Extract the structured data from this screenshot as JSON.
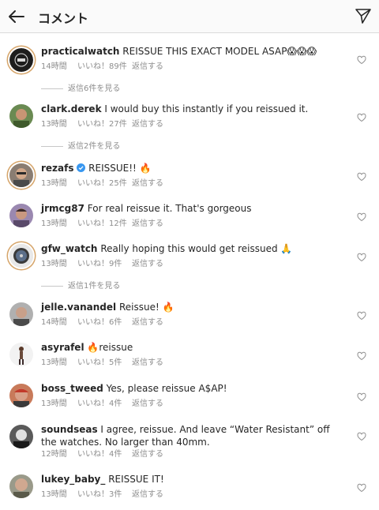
{
  "header": {
    "title": "コメント",
    "back_icon": "back-arrow-icon",
    "send_icon": "paper-plane-icon"
  },
  "comments": [
    {
      "username": "practicalwatch",
      "text": "REISSUE THIS EXACT MODEL ASAP😱😱😱",
      "time": "14時間",
      "likes": "いいね！89件",
      "reply": "返信する",
      "view_replies": "返信6件を見る"
    },
    {
      "username": "clark.derek",
      "text": "I would buy this instantly if you reissued it.",
      "time": "13時間",
      "likes": "いいね！27件",
      "reply": "返信する",
      "view_replies": "返信2件を見る"
    },
    {
      "username": "rezafs",
      "text": "REISSUE!! 🔥",
      "time": "13時間",
      "likes": "いいね！25件",
      "reply": "返信する",
      "verified": true
    },
    {
      "username": "jrmcg87",
      "text": "For real reissue it. That's gorgeous",
      "time": "13時間",
      "likes": "いいね！12件",
      "reply": "返信する"
    },
    {
      "username": "gfw_watch",
      "text": "Really hoping this would get reissued 🙏",
      "time": "13時間",
      "likes": "いいね！9件",
      "reply": "返信する",
      "view_replies": "返信1件を見る"
    },
    {
      "username": "jelle.vanandel",
      "text": "Reissue! 🔥",
      "time": "14時間",
      "likes": "いいね！6件",
      "reply": "返信する"
    },
    {
      "username": "asyrafel",
      "text": "🔥reissue",
      "time": "13時間",
      "likes": "いいね！5件",
      "reply": "返信する"
    },
    {
      "username": "boss_tweed",
      "text": "Yes, please reissue A$AP!",
      "time": "13時間",
      "likes": "いいね！4件",
      "reply": "返信する"
    },
    {
      "username": "soundseas",
      "text": "I agree, reissue. And leave “Water Resistant” off the watches. No larger than 40mm.",
      "time": "12時間",
      "likes": "いいね！4件",
      "reply": "返信する"
    },
    {
      "username": "lukey_baby_",
      "text": "REISSUE IT!",
      "time": "13時間",
      "likes": "いいね！3件",
      "reply": "返信する"
    }
  ]
}
